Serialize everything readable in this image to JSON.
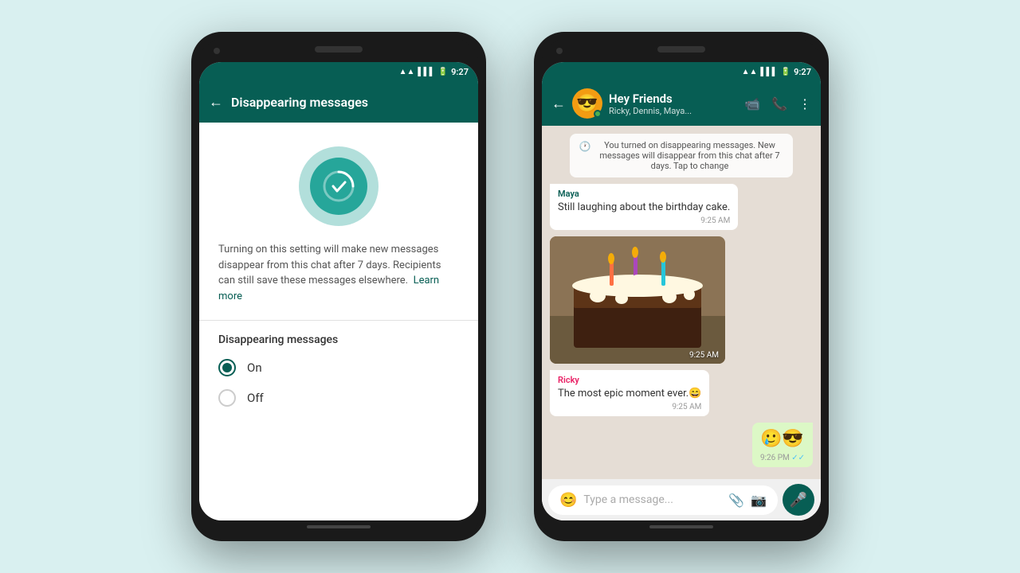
{
  "background": "#d9f0f0",
  "phone1": {
    "status_bar": {
      "time": "9:27"
    },
    "header": {
      "back_icon": "←",
      "title": "Disappearing messages"
    },
    "icon": {
      "check": "✓"
    },
    "description": {
      "text": "Turning on this setting will make new messages disappear from this chat after 7 days. Recipients can still save these messages elsewhere.",
      "learn_more": "Learn more"
    },
    "options_title": "Disappearing messages",
    "options": [
      {
        "label": "On",
        "selected": true
      },
      {
        "label": "Off",
        "selected": false
      }
    ]
  },
  "phone2": {
    "status_bar": {
      "time": "9:27"
    },
    "header": {
      "back_icon": "←",
      "group_name": "Hey Friends",
      "group_members": "Ricky, Dennis, Maya...",
      "video_icon": "▶",
      "call_icon": "📞",
      "menu_icon": "⋮"
    },
    "system_notification": {
      "icon": "🕐",
      "text": "You turned on disappearing messages. New messages will disappear from this chat after 7 days. Tap to change"
    },
    "messages": [
      {
        "type": "received",
        "sender": "Maya",
        "sender_color": "green",
        "text": "Still laughing about the birthday cake.",
        "time": "9:25 AM"
      },
      {
        "type": "image",
        "time": "9:25 AM"
      },
      {
        "type": "received",
        "sender": "Ricky",
        "sender_color": "pink",
        "text": "The most epic moment ever.😄",
        "time": "9:25 AM"
      },
      {
        "type": "sent",
        "text": "🥲😎",
        "time": "9:26 PM",
        "read": true
      }
    ],
    "input": {
      "placeholder": "Type a message...",
      "emoji_icon": "😊",
      "attach_icon": "📎",
      "camera_icon": "📷",
      "mic_icon": "🎤"
    }
  }
}
